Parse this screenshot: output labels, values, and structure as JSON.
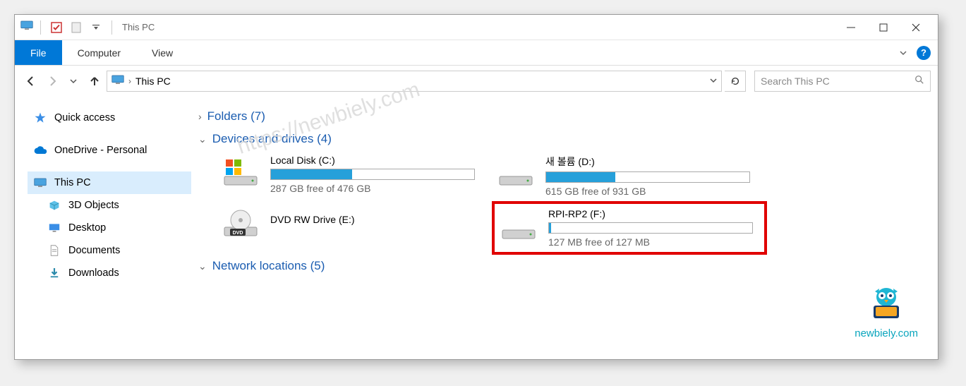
{
  "window_title": "This PC",
  "ribbon": {
    "file": "File",
    "computer": "Computer",
    "view": "View"
  },
  "breadcrumb": {
    "current": "This PC"
  },
  "search": {
    "placeholder": "Search This PC"
  },
  "sidebar": {
    "quick_access": "Quick access",
    "onedrive": "OneDrive - Personal",
    "this_pc": "This PC",
    "objects3d": "3D Objects",
    "desktop": "Desktop",
    "documents": "Documents",
    "downloads": "Downloads"
  },
  "groups": {
    "folders": "Folders (7)",
    "devices": "Devices and drives (4)",
    "network": "Network locations (5)"
  },
  "drives": {
    "c": {
      "name": "Local Disk (C:)",
      "free": "287 GB free of 476 GB",
      "fill_pct": 40
    },
    "d": {
      "name": "새 볼륨 (D:)",
      "free": "615 GB free of 931 GB",
      "fill_pct": 34
    },
    "e": {
      "name": "DVD RW Drive (E:)"
    },
    "f": {
      "name": "RPI-RP2 (F:)",
      "free": "127 MB free of 127 MB",
      "fill_pct": 1
    }
  },
  "watermark": "https://newbiely.com",
  "brand": "newbiely.com"
}
